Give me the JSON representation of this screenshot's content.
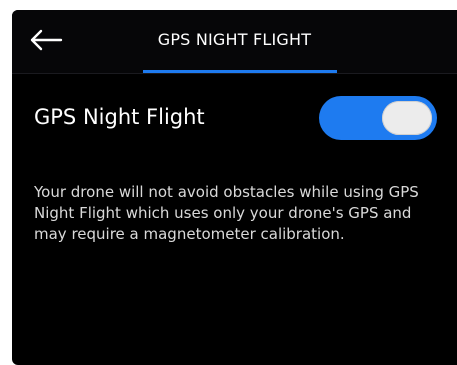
{
  "header": {
    "back_icon": "back-arrow-icon",
    "title": "GPS NIGHT FLIGHT"
  },
  "setting": {
    "label": "GPS Night Flight",
    "toggle_on": true,
    "accent_color": "#1e7bf0"
  },
  "description": "Your drone will not avoid obstacles while using GPS Night Flight which uses only your drone's GPS and may require a magnetometer calibration.",
  "background_color": "#000000"
}
